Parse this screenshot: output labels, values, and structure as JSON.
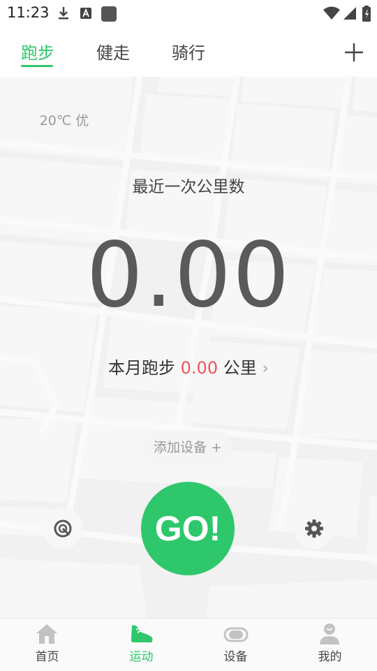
{
  "status_bar": {
    "time": "11:23"
  },
  "tabs": [
    {
      "label": "跑步",
      "active": true
    },
    {
      "label": "健走",
      "active": false
    },
    {
      "label": "骑行",
      "active": false
    }
  ],
  "weather": {
    "text": "20℃ 优"
  },
  "recent": {
    "label": "最近一次公里数",
    "value": "0.00"
  },
  "month": {
    "prefix": "本月跑步",
    "value": "0.00",
    "unit": "公里",
    "chevron": "›"
  },
  "add_device": {
    "label": "添加设备 +"
  },
  "go_button": {
    "label": "GO!"
  },
  "bottom_nav": [
    {
      "label": "首页",
      "icon": "home-icon",
      "active": false
    },
    {
      "label": "运动",
      "icon": "shoe-icon",
      "active": true
    },
    {
      "label": "设备",
      "icon": "band-icon",
      "active": false
    },
    {
      "label": "我的",
      "icon": "person-icon",
      "active": false
    }
  ],
  "colors": {
    "accent": "#2ec76b",
    "value_red": "#f0535e"
  }
}
